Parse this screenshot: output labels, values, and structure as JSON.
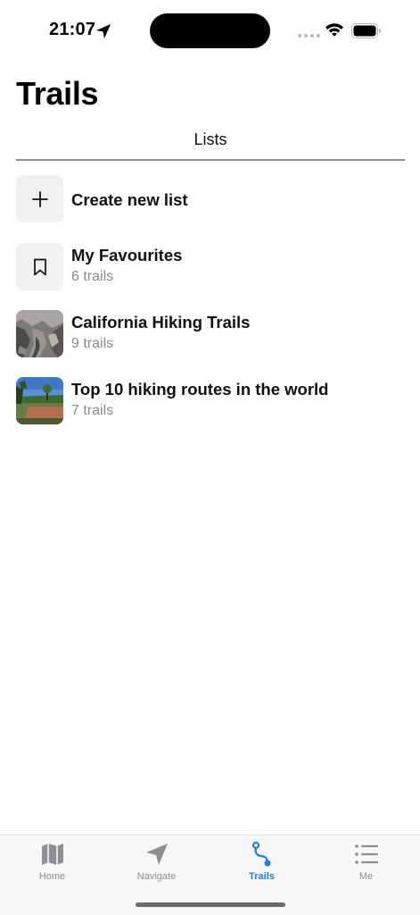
{
  "status_bar": {
    "time": "21:07"
  },
  "header": {
    "title": "Trails",
    "segment_label": "Lists"
  },
  "list": {
    "create": {
      "label": "Create new list",
      "icon": "plus-icon"
    },
    "items": [
      {
        "title": "My Favourites",
        "subtitle": "6 trails",
        "icon": "bookmark-icon"
      },
      {
        "title": "California Hiking Trails",
        "subtitle": "9 trails",
        "icon": "canyon-photo"
      },
      {
        "title": "Top 10 hiking routes in the world",
        "subtitle": "7 trails",
        "icon": "landscape-photo"
      }
    ]
  },
  "tab_bar": {
    "tabs": [
      {
        "label": "Home",
        "icon": "map-icon"
      },
      {
        "label": "Navigate",
        "icon": "navigation-arrow-icon"
      },
      {
        "label": "Trails",
        "icon": "route-icon",
        "active": true
      },
      {
        "label": "Me",
        "icon": "list-icon"
      }
    ],
    "active_color": "#1f7cf2",
    "inactive_color": "#8e8e93"
  }
}
